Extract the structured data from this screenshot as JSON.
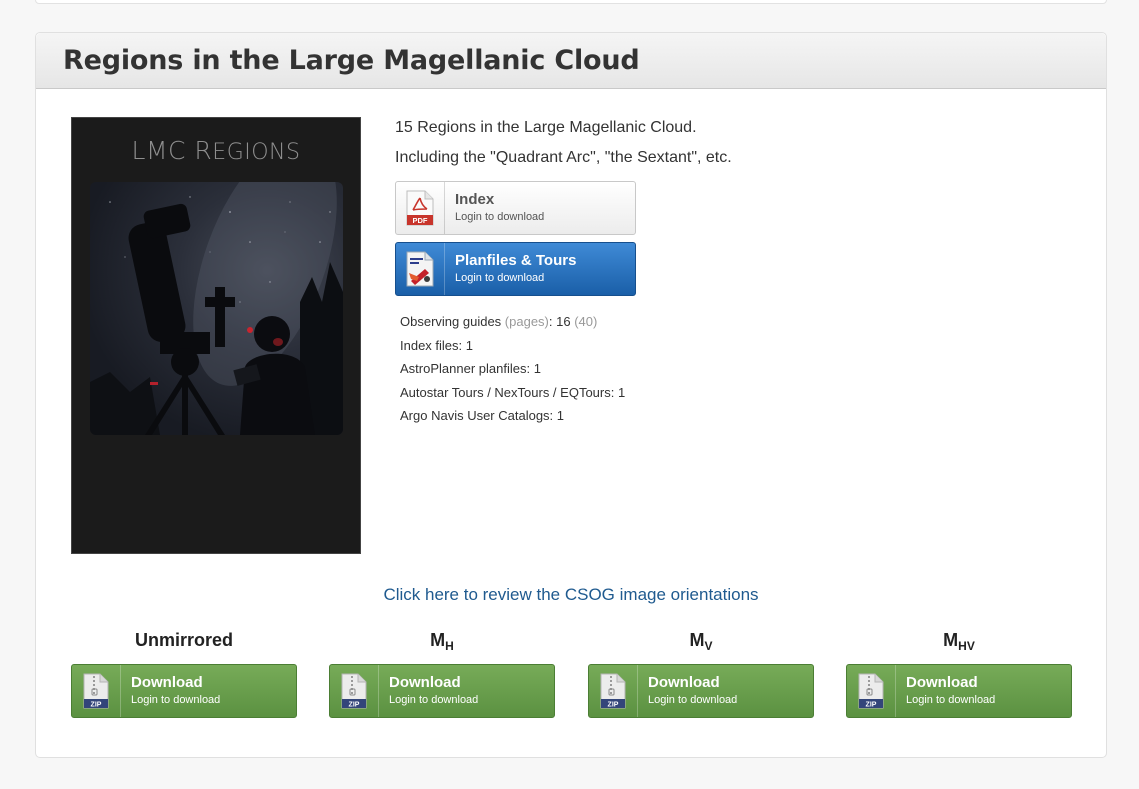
{
  "panel": {
    "title": "Regions in the Large Magellanic Cloud"
  },
  "cover": {
    "title_first_big": "LMC R",
    "title_rest": "EGIONS"
  },
  "description": {
    "line1": "15 Regions in the Large Magellanic Cloud.",
    "line2": "Including the \"Quadrant Arc\", \"the Sextant\", etc."
  },
  "buttons": {
    "index": {
      "label": "Index",
      "sub": "Login to download",
      "icon": "pdf-icon",
      "icon_text": "PDF"
    },
    "planfiles": {
      "label": "Planfiles & Tours",
      "sub": "Login to download",
      "icon": "planfile-icon"
    }
  },
  "stats": {
    "observing_label": "Observing guides",
    "observing_pages_word": "(pages)",
    "observing_value": "16",
    "observing_pages_value": "(40)",
    "index_label": "Index files:",
    "index_value": "1",
    "astroplanner_label": "AstroPlanner planfiles:",
    "astroplanner_value": "1",
    "autostar_label": "Autostar Tours / NexTours / EQTours:",
    "autostar_value": "1",
    "argo_label": "Argo Navis User Catalogs:",
    "argo_value": "1"
  },
  "orientation_link": "Click here to review the CSOG image orientations",
  "downloads": [
    {
      "label_main": "Unmirrored",
      "label_sub": "",
      "button": "Download",
      "sub": "Login to download",
      "icon_text": "ZIP"
    },
    {
      "label_main": "M",
      "label_sub": "H",
      "button": "Download",
      "sub": "Login to download",
      "icon_text": "ZIP"
    },
    {
      "label_main": "M",
      "label_sub": "V",
      "button": "Download",
      "sub": "Login to download",
      "icon_text": "ZIP"
    },
    {
      "label_main": "M",
      "label_sub": "HV",
      "button": "Download",
      "sub": "Login to download",
      "icon_text": "ZIP"
    }
  ],
  "colors": {
    "primary_blue": "#1a5fa8",
    "download_green": "#5b9141",
    "link_blue": "#1f5a8f"
  }
}
